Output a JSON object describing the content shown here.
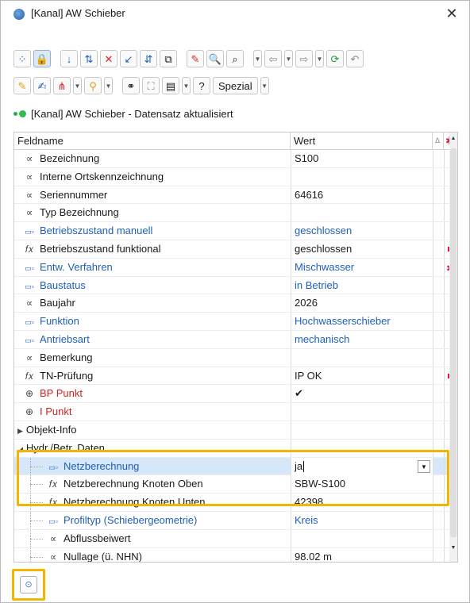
{
  "window": {
    "title": "[Kanal] AW Schieber",
    "close_glyph": "✕"
  },
  "toolbar1": {
    "buttons": [
      {
        "icon": "network-nodes-icon",
        "glyph": "⁘"
      },
      {
        "icon": "lock-icon",
        "glyph": "🔒"
      },
      {
        "icon": "arrow-down-icon",
        "glyph": "↓"
      },
      {
        "icon": "swap-arrows-icon",
        "glyph": "⇅"
      },
      {
        "icon": "delete-x-icon",
        "glyph": "✕"
      },
      {
        "icon": "arrow-down-left-icon",
        "glyph": "↙"
      },
      {
        "icon": "branch-arrows-icon",
        "glyph": "⇵"
      },
      {
        "icon": "copy-icon",
        "glyph": "⧉"
      },
      {
        "icon": "eraser-icon",
        "glyph": "✎"
      },
      {
        "icon": "find-folder-icon",
        "glyph": "🔍"
      },
      {
        "icon": "binoculars-icon",
        "glyph": "⌕"
      },
      {
        "icon": "back-arrow-icon",
        "glyph": "⇦"
      },
      {
        "icon": "forward-arrow-icon",
        "glyph": "⇨"
      },
      {
        "icon": "refresh-icon",
        "glyph": "⟳"
      },
      {
        "icon": "undo-icon",
        "glyph": "↶"
      }
    ]
  },
  "toolbar2": {
    "buttons": [
      {
        "icon": "pen-icon",
        "glyph": "✎"
      },
      {
        "icon": "edit-list-icon",
        "glyph": "✍"
      },
      {
        "icon": "fan-icon",
        "glyph": "⋔"
      },
      {
        "icon": "map-pin-icon",
        "glyph": "⚲"
      },
      {
        "icon": "hierarchy-icon",
        "glyph": "⚭"
      },
      {
        "icon": "camera-icon",
        "glyph": "⛶"
      },
      {
        "icon": "document-icon",
        "glyph": "▤"
      },
      {
        "icon": "help-icon",
        "glyph": "?"
      }
    ],
    "spezial_label": "Spezial"
  },
  "status": {
    "text": "[Kanal] AW Schieber  - Datensatz aktualisiert"
  },
  "grid": {
    "headers": {
      "name": "Feldname",
      "value": "Wert",
      "delta": "Δ",
      "star": "✱"
    },
    "rows": [
      {
        "icon": "alpha-icon",
        "glyph": "∝",
        "name": "Bezeichnung",
        "value": "S100",
        "name_color": "default",
        "value_color": "default",
        "mark": ""
      },
      {
        "icon": "alpha-icon",
        "glyph": "∝",
        "name": "Interne Ortskennzeichnung",
        "value": "",
        "name_color": "default",
        "value_color": "default",
        "mark": ""
      },
      {
        "icon": "alpha-icon",
        "glyph": "∝",
        "name": "Seriennummer",
        "value": "64616",
        "name_color": "default",
        "value_color": "default",
        "mark": ""
      },
      {
        "icon": "alpha-icon",
        "glyph": "∝",
        "name": "Typ Bezeichnung",
        "value": "",
        "name_color": "default",
        "value_color": "default",
        "mark": ""
      },
      {
        "icon": "list-icon",
        "glyph": "▭▫",
        "name": "Betriebszustand manuell",
        "value": "geschlossen",
        "name_color": "blue",
        "value_color": "blue",
        "mark": ""
      },
      {
        "icon": "function-icon",
        "glyph": "𝑓𝑥",
        "name": "Betriebszustand funktional",
        "value": "geschlossen",
        "name_color": "default",
        "value_color": "default",
        "mark": "square"
      },
      {
        "icon": "list-icon",
        "glyph": "▭▫",
        "name": "Entw. Verfahren",
        "value": "Mischwasser",
        "name_color": "blue",
        "value_color": "blue",
        "mark": "star"
      },
      {
        "icon": "list-icon",
        "glyph": "▭▫",
        "name": "Baustatus",
        "value": "in Betrieb",
        "name_color": "blue",
        "value_color": "blue",
        "mark": ""
      },
      {
        "icon": "alpha-icon",
        "glyph": "∝",
        "name": "Baujahr",
        "value": "2026",
        "name_color": "default",
        "value_color": "default",
        "mark": ""
      },
      {
        "icon": "list-icon",
        "glyph": "▭▫",
        "name": "Funktion",
        "value": "Hochwasserschieber",
        "name_color": "blue",
        "value_color": "blue",
        "mark": ""
      },
      {
        "icon": "list-icon",
        "glyph": "▭▫",
        "name": "Antriebsart",
        "value": "mechanisch",
        "name_color": "blue",
        "value_color": "blue",
        "mark": ""
      },
      {
        "icon": "alpha-icon",
        "glyph": "∝",
        "name": "Bemerkung",
        "value": "",
        "name_color": "default",
        "value_color": "default",
        "mark": ""
      },
      {
        "icon": "function-icon",
        "glyph": "𝑓𝑥",
        "name": "TN-Prüfung",
        "value": "IP OK",
        "name_color": "default",
        "value_color": "default",
        "mark": "square"
      },
      {
        "icon": "crosshair-icon",
        "glyph": "⊕",
        "name": "BP Punkt",
        "value": "✔",
        "name_color": "red",
        "value_color": "default",
        "mark": ""
      },
      {
        "icon": "crosshair-icon",
        "glyph": "⊕",
        "name": "I Punkt",
        "value": "",
        "name_color": "red",
        "value_color": "default",
        "mark": ""
      }
    ],
    "group_objekt": {
      "label": "Objekt-Info",
      "toggle": "▶"
    },
    "group_hydr": {
      "label": "Hydr./Betr. Daten",
      "toggle": "◢"
    },
    "sub_rows": [
      {
        "icon": "list-icon",
        "glyph": "▭▫",
        "name": "Netzberechnung",
        "value": "ja",
        "name_color": "blue",
        "value_color": "default",
        "mark": "",
        "selected": true
      },
      {
        "icon": "function-icon",
        "glyph": "𝑓𝑥",
        "name": "Netzberechnung Knoten Oben",
        "value": "SBW-S100",
        "name_color": "default",
        "value_color": "default",
        "mark": "square"
      },
      {
        "icon": "function-icon",
        "glyph": "𝑓𝑥",
        "name": "Netzberechnung Knoten Unten",
        "value": "42398",
        "name_color": "default",
        "value_color": "default",
        "mark": "square"
      },
      {
        "icon": "list-icon",
        "glyph": "▭▫",
        "name": "Profiltyp (Schiebergeometrie)",
        "value": "Kreis",
        "name_color": "blue",
        "value_color": "blue",
        "mark": ""
      },
      {
        "icon": "alpha-icon",
        "glyph": "∝",
        "name": "Abflussbeiwert",
        "value": "",
        "name_color": "default",
        "value_color": "default",
        "mark": ""
      },
      {
        "icon": "alpha-icon",
        "glyph": "∝",
        "name": "Nullage (ü. NHN)",
        "value": "98.02 m",
        "name_color": "default",
        "value_color": "default",
        "mark": ""
      }
    ]
  },
  "bottom_button": {
    "icon": "network-settings-icon",
    "glyph": "⊙"
  },
  "colors": {
    "blue": "#1f5fb8",
    "red": "#d22222",
    "mark_red": "#e0163b",
    "highlight": "#f5b400",
    "status_green": "#2fbf50"
  }
}
